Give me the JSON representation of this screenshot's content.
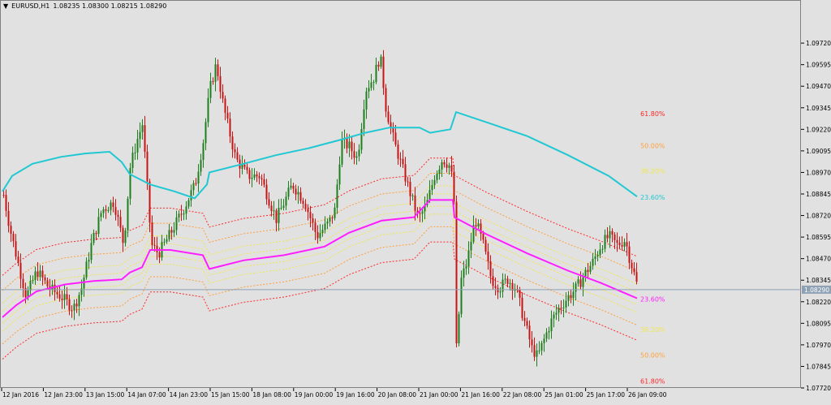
{
  "header": {
    "symbol": "EURUSD,H1",
    "ohlc": "1.08235 1.08300 1.08215 1.08290"
  },
  "chart_data": {
    "type": "candlestick",
    "title": "EURUSD,H1",
    "ylim": [
      1.0772,
      1.0997
    ],
    "y_ticks": [
      "1.09720",
      "1.09595",
      "1.09470",
      "1.09345",
      "1.09220",
      "1.09095",
      "1.08970",
      "1.08845",
      "1.08720",
      "1.08595",
      "1.08470",
      "1.08345",
      "1.08220",
      "1.08095",
      "1.07970",
      "1.07845",
      "1.07720"
    ],
    "x_ticks": [
      "12 Jan 2016",
      "12 Jan 23:00",
      "13 Jan 15:00",
      "14 Jan 07:00",
      "14 Jan 23:00",
      "15 Jan 15:00",
      "18 Jan 08:00",
      "19 Jan 00:00",
      "19 Jan 16:00",
      "20 Jan 08:00",
      "21 Jan 00:00",
      "21 Jan 16:00",
      "22 Jan 08:00",
      "25 Jan 01:00",
      "25 Jan 17:00",
      "26 Jan 09:00"
    ],
    "current_price": "1.08290",
    "colors": {
      "bull": "#1f7f1f",
      "bear": "#c81414",
      "cyan": "#1fc8d2",
      "magenta": "#ff1eff",
      "red": "#ff2828",
      "orange": "#ffa03c",
      "yellow": "#f0e650",
      "price_line": "#8ea0b4"
    },
    "fib_labels": [
      {
        "text": "61.80%",
        "value": 1.0931,
        "color": "#ff2828"
      },
      {
        "text": "50.00%",
        "value": 1.09125,
        "color": "#ffa03c"
      },
      {
        "text": "38.20%",
        "value": 1.0898,
        "color": "#f0e650"
      },
      {
        "text": "23.60%",
        "value": 1.08825,
        "color": "#1fc8d2"
      },
      {
        "text": "23.60%",
        "value": 1.08235,
        "color": "#ff1eff"
      },
      {
        "text": "38.20%",
        "value": 1.0806,
        "color": "#f0e650"
      },
      {
        "text": "50.00%",
        "value": 1.0791,
        "color": "#ffa03c"
      },
      {
        "text": "61.80%",
        "value": 1.0776,
        "color": "#ff2828"
      }
    ]
  }
}
